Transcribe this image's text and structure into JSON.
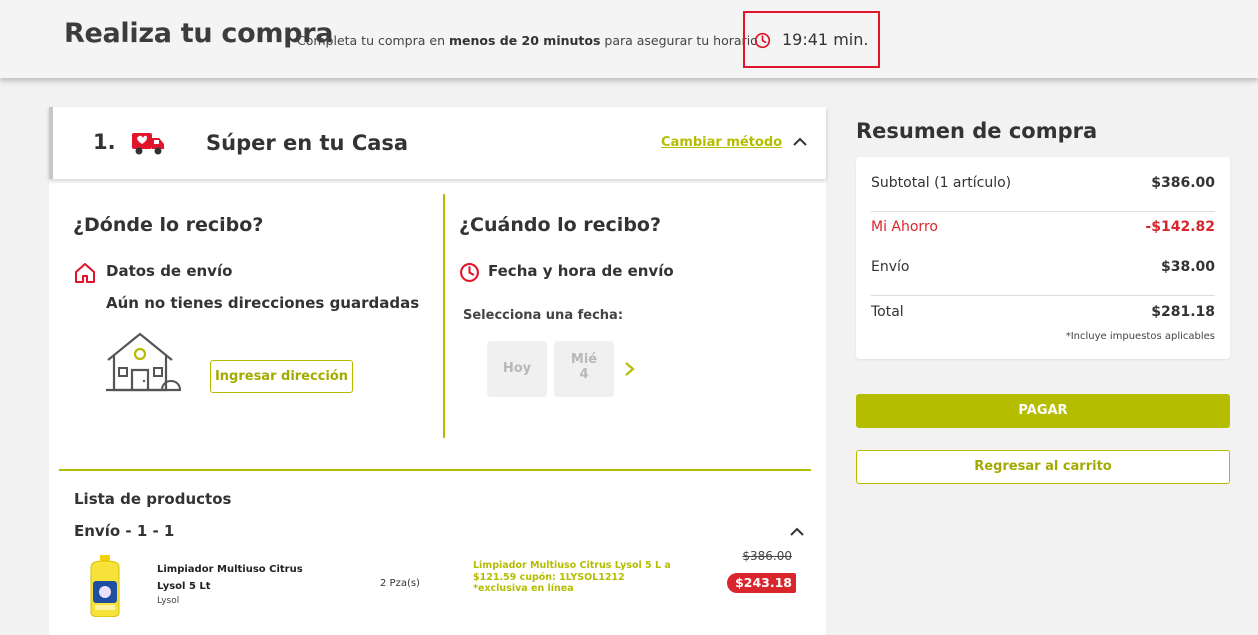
{
  "header": {
    "title": "Realiza tu compra",
    "subtitle_prefix": "Completa tu compra en",
    "subtitle_bold": "menos de 20 minutos",
    "subtitle_suffix": "para asegurar tu horario",
    "timer": "19:41 min."
  },
  "method": {
    "step": "1.",
    "title": "Súper en tu Casa",
    "change_link": "Cambiar método"
  },
  "where": {
    "title": "¿Dónde lo recibo?",
    "label": "Datos de envío",
    "empty_text": "Aún no tienes direcciones guardadas",
    "button": "Ingresar dirección"
  },
  "when": {
    "title": "¿Cuándo lo recibo?",
    "label": "Fecha y hora de envío",
    "select_label": "Selecciona una fecha:",
    "days": [
      {
        "line1": "Hoy",
        "line2": ""
      },
      {
        "line1": "Mié",
        "line2": "4"
      }
    ]
  },
  "products": {
    "title": "Lista de productos",
    "shipment": "Envío - 1 - 1",
    "items": [
      {
        "name_line1": "Limpiador Multiuso Citrus",
        "name_line2": "Lysol 5 Lt",
        "brand": "Lysol",
        "qty": "2 Pza(s)",
        "promo": "Limpiador Multiuso Citrus Lysol 5 L a $121.59 cupón: 1LYSOL1212 *exclusiva en línea",
        "old_price": "$386.00",
        "price": "$243.18"
      }
    ]
  },
  "summary": {
    "title": "Resumen de compra",
    "subtotal_label": "Subtotal (1 artículo)",
    "subtotal": "$386.00",
    "savings_label": "Mi Ahorro",
    "savings": "-$142.82",
    "shipping_label": "Envío",
    "shipping": "$38.00",
    "total_label": "Total",
    "total": "$281.18",
    "tax_note": "*Incluye impuestos aplicables",
    "pay_button": "PAGAR",
    "back_button": "Regresar al carrito"
  },
  "colors": {
    "accent": "#b5bd00",
    "alert": "#e0142a",
    "discount": "#d9262c"
  }
}
